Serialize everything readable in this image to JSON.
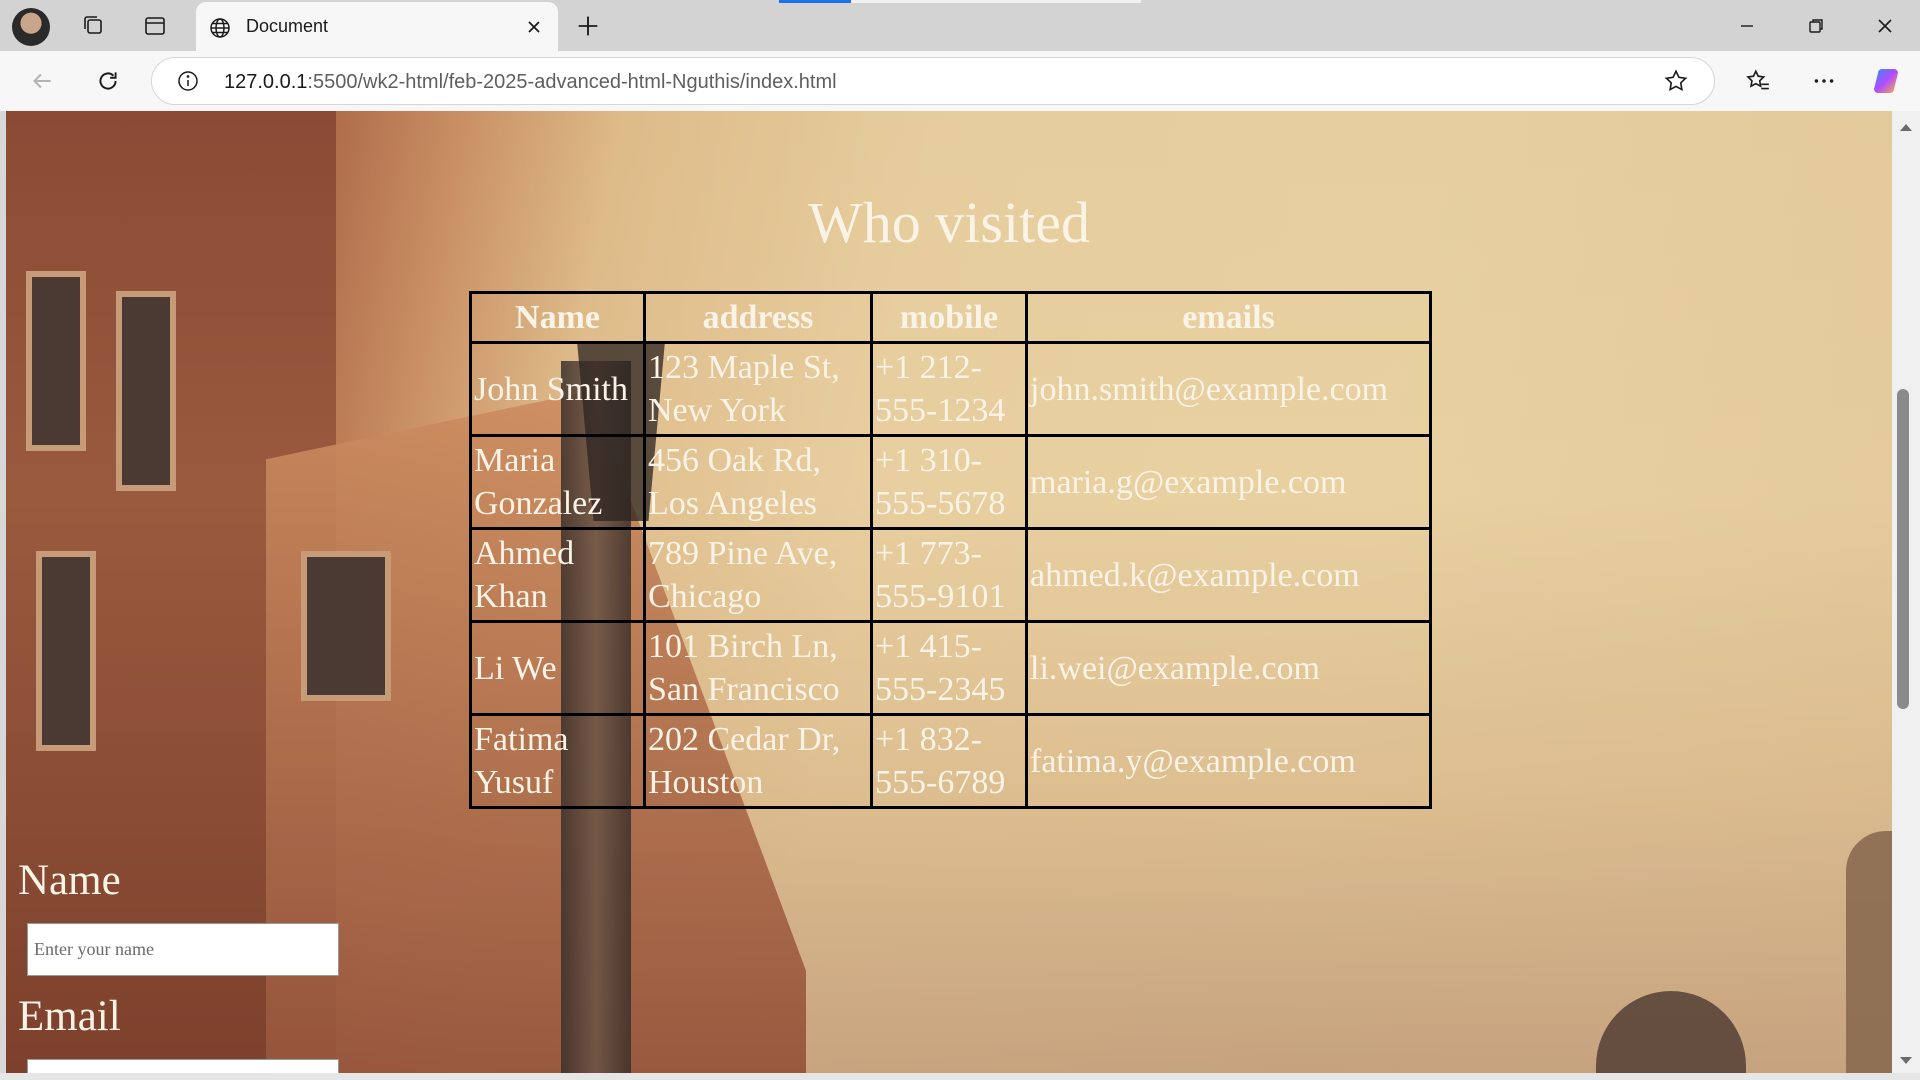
{
  "browser": {
    "tab_title": "Document",
    "url_host": "127.0.0.1",
    "url_path": ":5500/wk2-html/feb-2025-advanced-html-Nguthis/index.html"
  },
  "page": {
    "heading": "Who visited",
    "table": {
      "headers": [
        "Name",
        "address",
        "mobile",
        "emails"
      ],
      "rows": [
        [
          "John Smith",
          "123 Maple St, New York",
          "+1 212-555-1234",
          "john.smith@example.com"
        ],
        [
          "Maria Gonzalez",
          "456 Oak Rd, Los Angeles",
          "+1 310-555-5678",
          "maria.g@example.com"
        ],
        [
          "Ahmed Khan",
          "789 Pine Ave, Chicago",
          "+1 773-555-9101",
          "ahmed.k@example.com"
        ],
        [
          "Li We",
          "101 Birch Ln, San Francisco",
          "+1 415-555-2345",
          "li.wei@example.com"
        ],
        [
          "Fatima Yusuf",
          "202 Cedar Dr, Houston",
          "+1 832-555-6789",
          "fatima.y@example.com"
        ]
      ]
    },
    "form": {
      "name_label": "Name",
      "name_placeholder": "Enter your name",
      "email_label": "Email"
    }
  },
  "icons": {
    "avatar": "profile-avatar",
    "collections": "collections-icon",
    "vertical_tabs": "tab-actions-icon",
    "tab_favicon": "globe-icon",
    "close": "close-icon",
    "new_tab": "plus-icon",
    "minimize": "minimize-icon",
    "restore": "restore-icon",
    "window_close": "close-icon",
    "back": "back-arrow-icon",
    "refresh": "refresh-icon",
    "site_info": "info-icon",
    "favorite": "star-icon",
    "favorites": "favorites-icon",
    "more": "more-icon",
    "copilot": "copilot-icon"
  },
  "colors": {
    "accent": "#1a73e8",
    "page_text": "#fbf3e6"
  }
}
